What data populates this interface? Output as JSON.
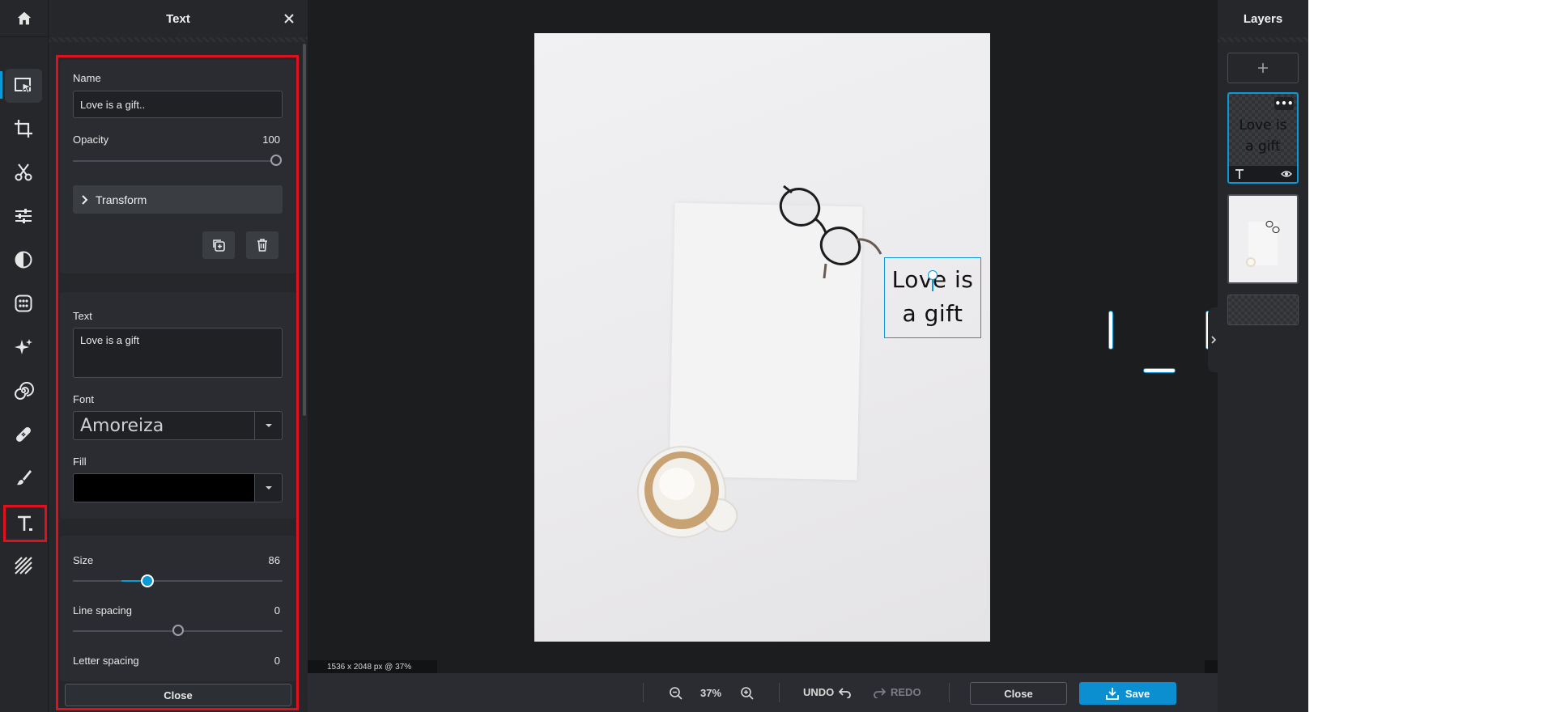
{
  "panel": {
    "title": "Text",
    "name_label": "Name",
    "name_value": "Love is a gift..",
    "opacity_label": "Opacity",
    "opacity_value": "100",
    "opacity_level": 1.0,
    "transform_label": "Transform",
    "text_label": "Text",
    "text_value": "Love is a gift",
    "font_label": "Font",
    "font_value": "Amoreiza",
    "fill_label": "Fill",
    "fill_color": "#000000",
    "size_label": "Size",
    "size_value": "86",
    "line_spacing_label": "Line spacing",
    "line_spacing_value": "0",
    "letter_spacing_label": "Letter spacing",
    "letter_spacing_value": "0",
    "close_label": "Close"
  },
  "toolbar": {
    "items": [
      "home-icon",
      "select-icon",
      "crop-icon",
      "cut-icon",
      "adjust-icon",
      "filter-icon",
      "effects-icon",
      "retouch-icon",
      "liquify-icon",
      "heal-icon",
      "draw-icon",
      "text-icon",
      "pattern-icon"
    ],
    "active": "text-icon"
  },
  "canvas": {
    "text_line_1": "Love is",
    "text_line_2": "a gift",
    "status": "1536 x 2048 px @ 37%"
  },
  "bottom": {
    "zoom": "37%",
    "undo": "UNDO",
    "redo": "REDO",
    "close": "Close",
    "save": "Save"
  },
  "layers": {
    "title": "Layers",
    "text_layer_line_1": "Love is",
    "text_layer_line_2": "a gift"
  },
  "colors": {
    "accent": "#0b9ad8",
    "highlight": "#e0101f"
  }
}
